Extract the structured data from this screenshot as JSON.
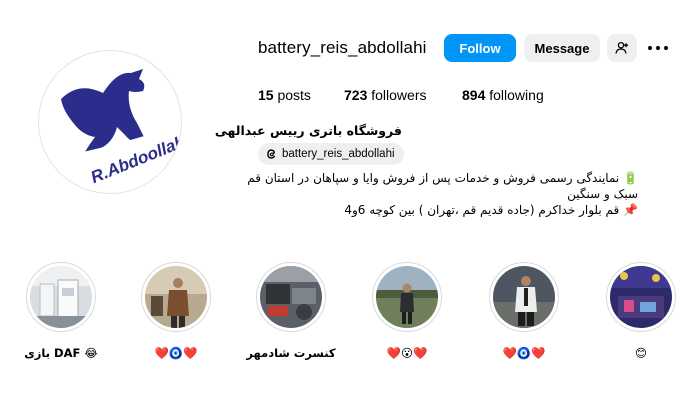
{
  "profile": {
    "username": "battery_reis_abdollahi",
    "avatar_logo_text": "R.Abdoollahi",
    "full_name": "فروشگاه باتری رییس عبدالهی",
    "threads_handle": "battery_reis_abdollahi",
    "bio_lines": [
      "🔋 نمایندگی رسمی فروش و خدمات پس از فروش وایا و سپاهان در استان قم",
      "سبک و سنگین",
      "📌 قم بلوار خداکرم (جاده قدیم قم ،تهران ) بین کوچه 6و4"
    ]
  },
  "actions": {
    "follow_label": "Follow",
    "message_label": "Message"
  },
  "stats": {
    "posts_count": "15",
    "posts_label": "posts",
    "followers_count": "723",
    "followers_label": "followers",
    "following_count": "894",
    "following_label": "following"
  },
  "highlights": [
    {
      "label_text": "بازی DAF 😂",
      "icon": "gym-machine-photo"
    },
    {
      "label_text": "❤️🧿❤️",
      "icon": "man-portrait-photo"
    },
    {
      "label_text": "کنسرت شادمهر",
      "icon": "car-engine-photo"
    },
    {
      "label_text": "❤️😮❤️",
      "icon": "outdoor-portrait-photo"
    },
    {
      "label_text": "❤️🧿❤️",
      "icon": "suit-portrait-photo"
    },
    {
      "label_text": "😊",
      "icon": "concert-stage-photo"
    }
  ],
  "colors": {
    "follow_button": "#0095f6",
    "secondary_button": "#efefef",
    "avatar_kangaroo": "#2a2d8c"
  }
}
